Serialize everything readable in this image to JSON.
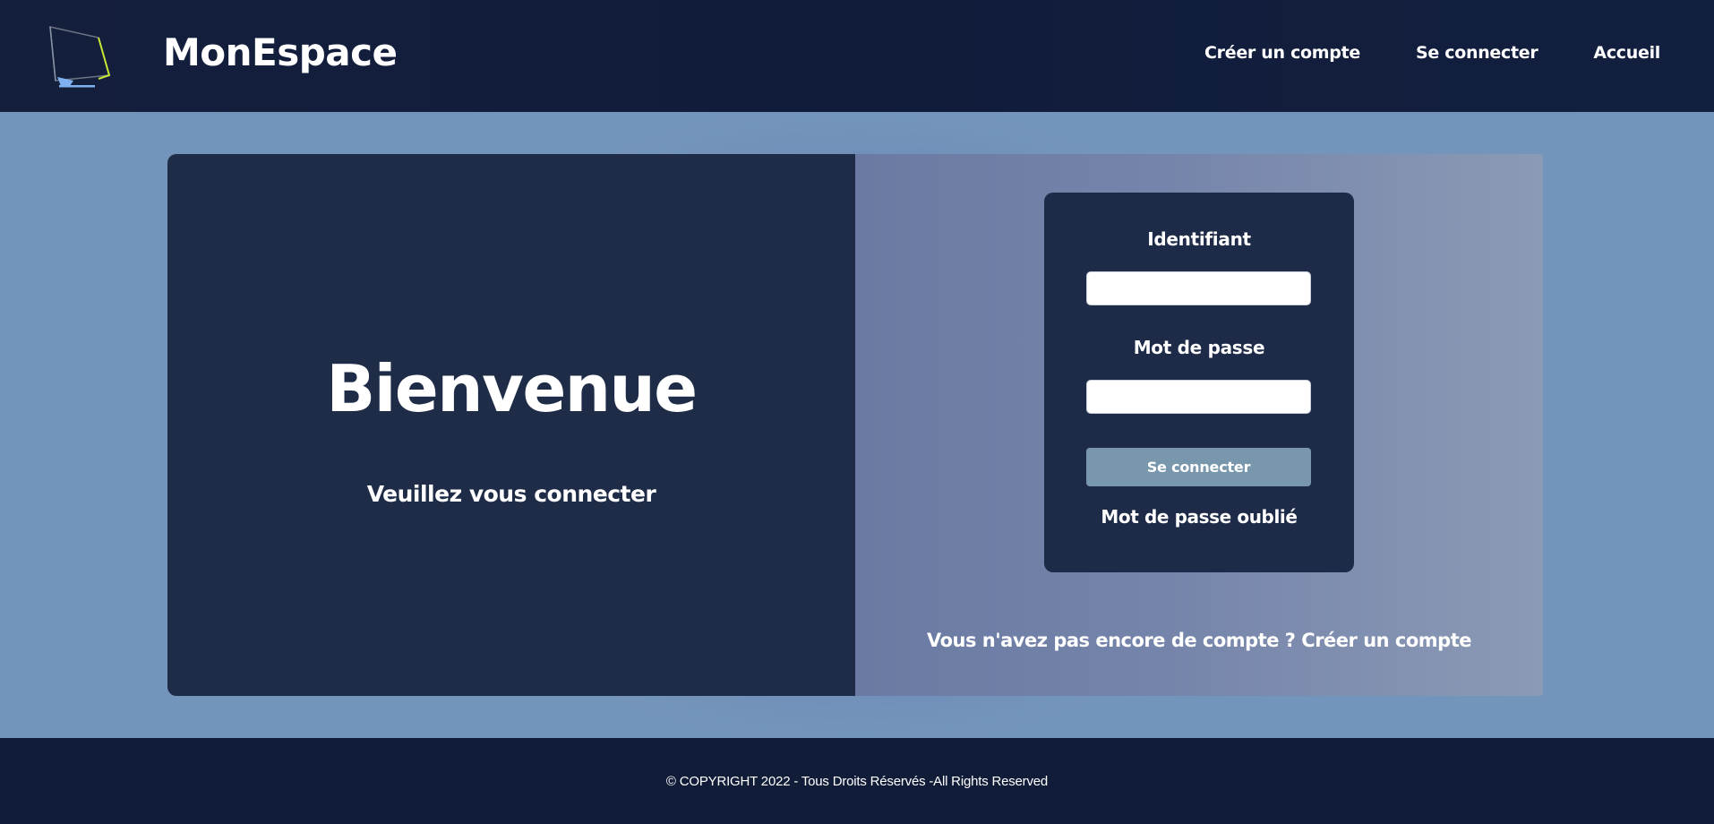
{
  "header": {
    "brand": "MonEspace",
    "logo_icon": "monitor-icon",
    "nav": [
      {
        "label": "Créer un compte"
      },
      {
        "label": "Se connecter"
      },
      {
        "label": "Accueil"
      }
    ]
  },
  "welcome_panel": {
    "title": "Bienvenue",
    "subtitle": "Veuillez vous connecter"
  },
  "login_form": {
    "username_label": "Identifiant",
    "username_value": "",
    "password_label": "Mot de passe",
    "password_value": "",
    "submit_label": "Se connecter",
    "forgot_label": "Mot de passe oublié"
  },
  "signup_prompt": {
    "text": "Vous n'avez pas encore de compte ?",
    "link": "Créer un compte"
  },
  "footer": {
    "copyright": "© COPYRIGHT 2022 - Tous Droits Réservés -All Rights Reserved"
  },
  "colors": {
    "header_bg": "#141f3c",
    "page_bg": "#7495bb",
    "panel_dark": "#1e2c48",
    "button_bg": "#7897ad",
    "logo_accent": "#c7e635",
    "logo_stand": "#7fb1f0"
  }
}
